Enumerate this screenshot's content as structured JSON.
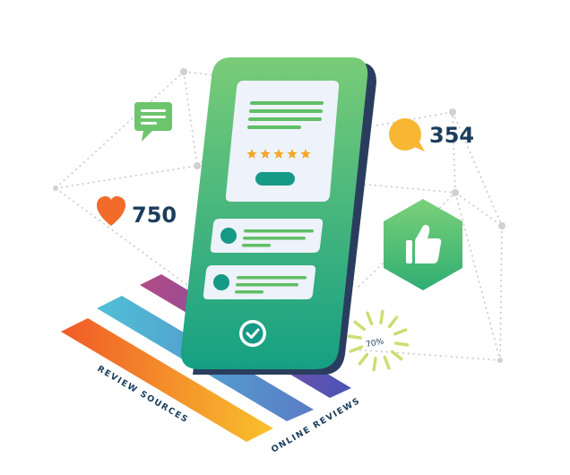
{
  "stats": {
    "likes_count": "750",
    "comments_count": "354",
    "percent": "70%"
  },
  "labels": {
    "review_sources": "REVIEW SOURCES",
    "online_reviews": "ONLINE REVIEWS"
  },
  "rating": {
    "stars": 5,
    "max": 5
  },
  "colors": {
    "phone_green": "#3db27a",
    "phone_green_light": "#7ccf7a",
    "navy": "#1b3d5c",
    "heart": "#f26b2a",
    "bubble_yellow": "#f7b733",
    "chat_green": "#6cc56d",
    "star": "#f5a623"
  },
  "icons": {
    "heart": "heart-icon",
    "speech": "speech-bubble-icon",
    "chat": "chat-message-icon",
    "thumbs_up": "thumbs-up-icon",
    "check": "checkmark-icon"
  }
}
